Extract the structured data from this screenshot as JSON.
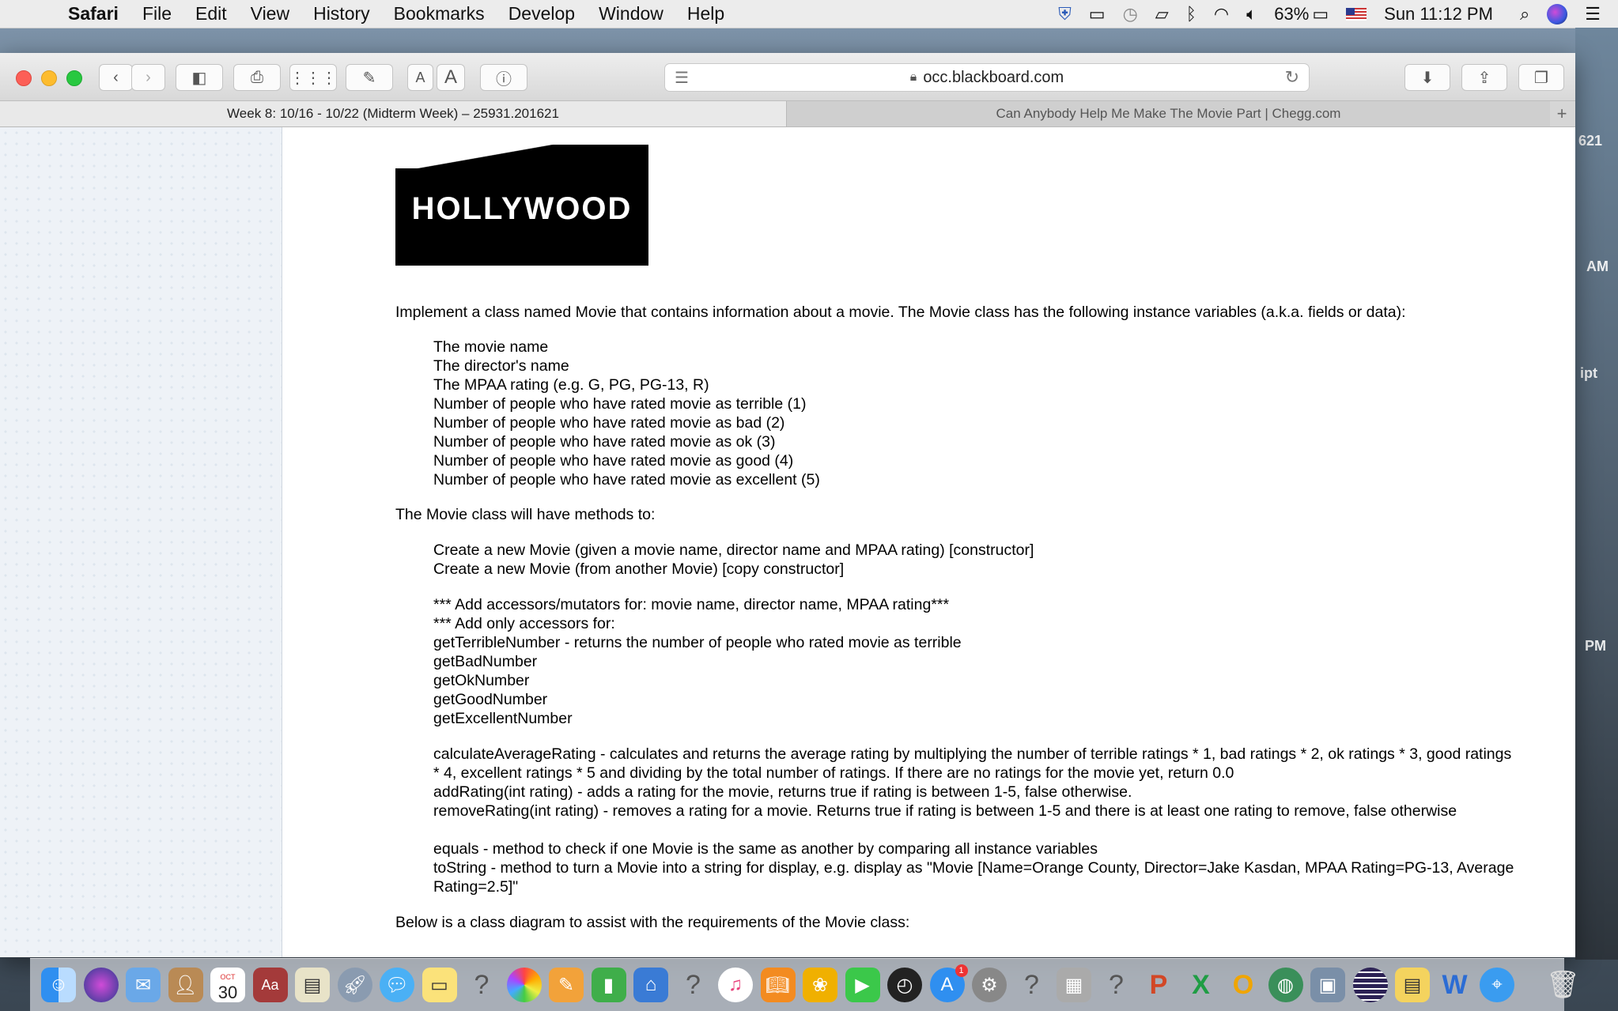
{
  "menubar": {
    "app": "Safari",
    "menus": [
      "File",
      "Edit",
      "View",
      "History",
      "Bookmarks",
      "Develop",
      "Window",
      "Help"
    ],
    "battery": "63%",
    "clock": "Sun 11:12 PM"
  },
  "browser": {
    "url": "occ.blackboard.com",
    "tabs": [
      {
        "label": "Week 8: 10/16 - 10/22 (Midterm Week) – 25931.201621"
      },
      {
        "label": "Can Anybody Help Me Make The Movie Part | Chegg.com"
      }
    ],
    "font_small": "A",
    "font_large": "A"
  },
  "content": {
    "logo_text": "HOLLYWOOD",
    "intro": "Implement a class named Movie that contains information about a movie.  The Movie class has the following instance variables (a.k.a. fields or data):",
    "fields": [
      "The movie name",
      "The director's name",
      "The MPAA rating (e.g. G, PG, PG-13, R)",
      "Number of people who have rated movie as terrible (1)",
      "Number of people who have rated movie as bad (2)",
      "Number of people who have rated movie as ok (3)",
      "Number of people who have rated movie as good (4)",
      "Number of people who have rated movie as excellent (5)"
    ],
    "methods_intro": "The Movie class will have methods to:",
    "constructors": [
      "Create a new Movie (given a movie name, director name and MPAA rating) [constructor]",
      "Create a new Movie (from another Movie) [copy constructor]"
    ],
    "accessors": [
      "*** Add accessors/mutators for: movie name, director name, MPAA rating***",
      "*** Add only accessors for:",
      "getTerribleNumber - returns the number of people who rated movie as terrible",
      "getBadNumber",
      "getOkNumber",
      "getGoodNumber",
      "getExcellentNumber"
    ],
    "others": [
      "calculateAverageRating - calculates and returns the average rating by multiplying the number of terrible ratings * 1, bad ratings * 2, ok ratings * 3, good ratings * 4, excellent ratings * 5 and dividing by the total number of ratings.  If there are no ratings for the movie yet, return 0.0",
      "addRating(int rating) - adds a rating for the movie, returns true if rating is between 1-5, false otherwise.",
      "removeRating(int rating) - removes a rating for a movie.  Returns true if rating is between 1-5 and there is at least one rating to remove, false otherwise",
      "equals - method to check if one Movie is the same as another by comparing all instance variables",
      "toString - method to turn a Movie into a string for display, e.g. display as \"Movie [Name=Orange County, Director=Jake Kasdan, MPAA Rating=PG-13, Average Rating=2.5]\""
    ],
    "diagram_intro": "Below is a class diagram to assist with the requirements of the Movie class:"
  },
  "background_labels": [
    "621",
    "AM",
    "ipt",
    "PM"
  ],
  "dock": {
    "calendar_month": "OCT",
    "calendar_day": "30",
    "dictionary": "Aa",
    "appstore_badge": "1"
  }
}
